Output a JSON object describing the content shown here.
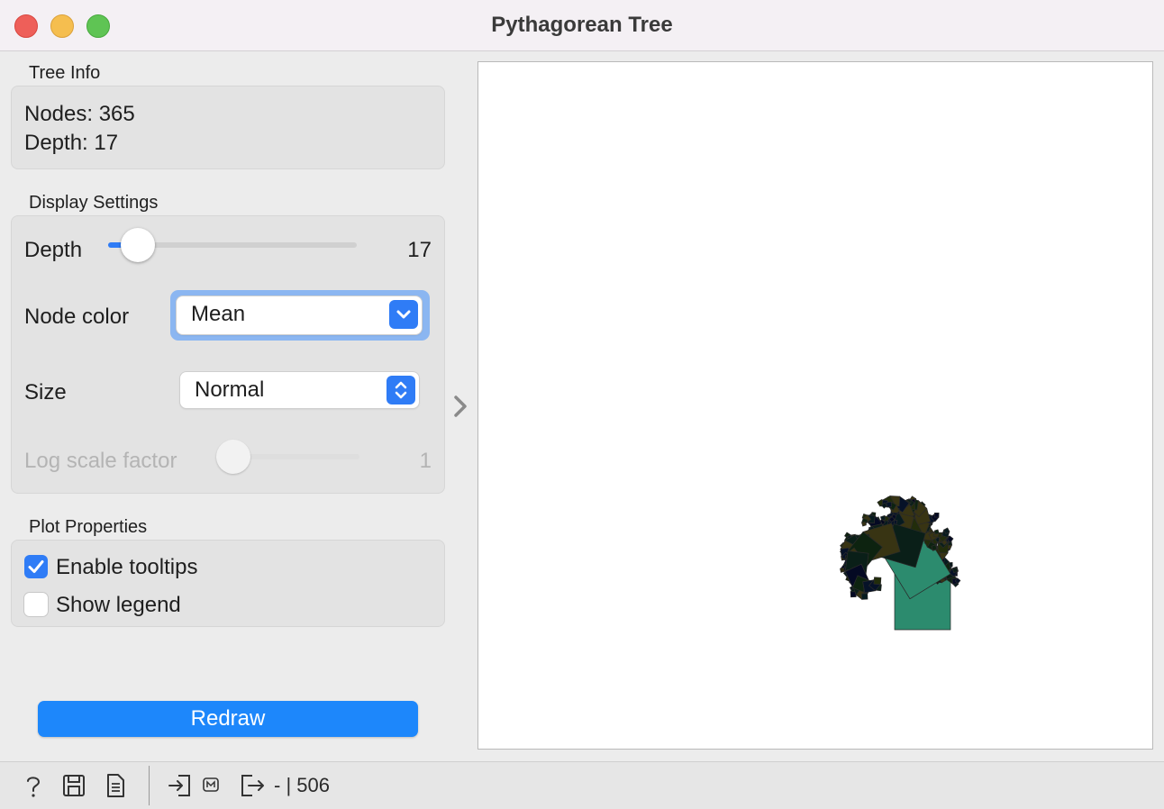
{
  "window": {
    "title": "Pythagorean Tree"
  },
  "tree_info": {
    "section_title": "Tree Info",
    "nodes_text": "Nodes: 365",
    "depth_text": "Depth: 17"
  },
  "display_settings": {
    "section_title": "Display Settings",
    "depth_label": "Depth",
    "depth_value": "17",
    "depth_slider_fraction": 0.05,
    "node_color_label": "Node color",
    "node_color_value": "Mean",
    "size_label": "Size",
    "size_value": "Normal",
    "log_scale_label": "Log scale factor",
    "log_scale_value": "1",
    "log_scale_enabled": false
  },
  "plot_properties": {
    "section_title": "Plot Properties",
    "enable_tooltips_label": "Enable tooltips",
    "enable_tooltips_checked": true,
    "show_legend_label": "Show legend",
    "show_legend_checked": false
  },
  "redraw_label": "Redraw",
  "status_bar": {
    "data_text": "- | 506",
    "icons": [
      "help-icon",
      "save-icon",
      "report-icon",
      "input-icon",
      "input-badge-icon",
      "output-icon"
    ]
  },
  "colors": {
    "accent": "#2f7cf6",
    "redraw": "#1d87fb",
    "tree_palette": [
      "#1e7a8e",
      "#2c8b6e",
      "#3aa14a",
      "#9acd32",
      "#ffee55",
      "#1a54b8",
      "#1428a0"
    ]
  }
}
